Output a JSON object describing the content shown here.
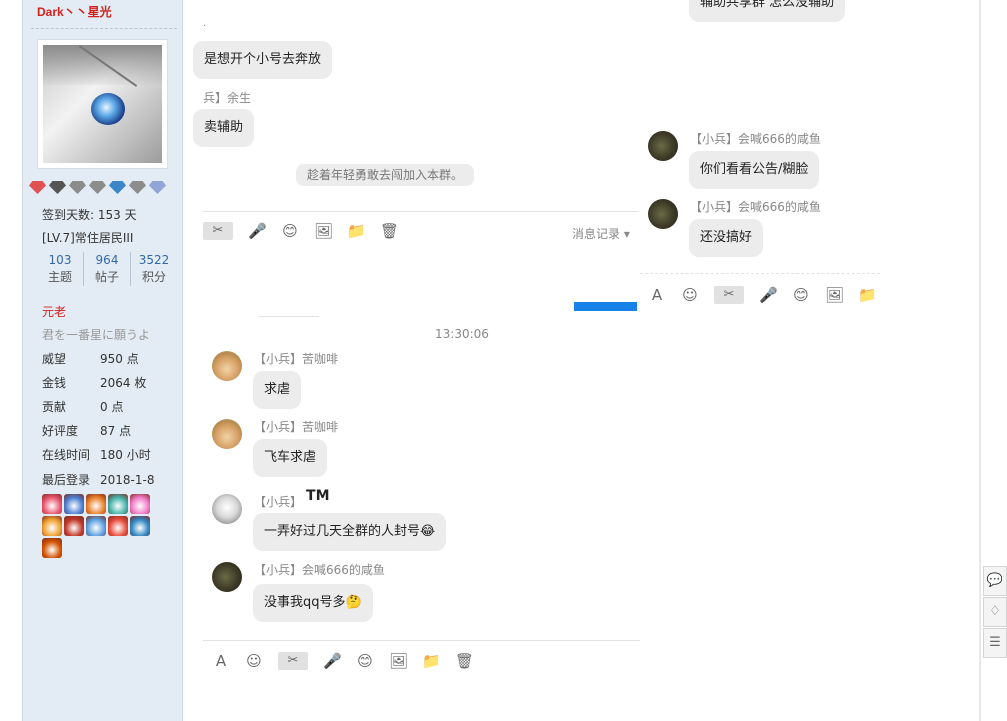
{
  "profile": {
    "username": "Dark丶丶星光",
    "checkin": "签到天数: 153 天",
    "level": "[LV.7]常住居民III",
    "stats": [
      {
        "num": "103",
        "label": "主题"
      },
      {
        "num": "964",
        "label": "帖子"
      },
      {
        "num": "3522",
        "label": "积分"
      }
    ],
    "rank": "元老",
    "motto": "君を一番星に願うよ",
    "details": [
      {
        "k": "威望",
        "v": "950 点"
      },
      {
        "k": "金钱",
        "v": "2064 枚"
      },
      {
        "k": "贡献",
        "v": "0 点"
      },
      {
        "k": "好评度",
        "v": "87 点"
      },
      {
        "k": "在线时间",
        "v": "180 小时"
      },
      {
        "k": "最后登录",
        "v": "2018-1-8"
      }
    ],
    "badge_colors": [
      "#e05252",
      "#555555",
      "#8c8c8c",
      "#8c8c8c",
      "#3a86c8",
      "#8c8c8c",
      "#8fa6d6"
    ],
    "medal_colors": [
      "#e8576f",
      "#4a7fd4",
      "#e87f2a",
      "#43b3a8",
      "#f07ac6",
      "#f0a030",
      "#c0392b",
      "#5aa0e0",
      "#e74c3c",
      "#2e86c1",
      "#d35400"
    ]
  },
  "upper_left": {
    "msg1": "是想开个小号去奔放",
    "sender2": "兵】余生",
    "msg2": "卖辅助",
    "system": "趁着年轻勇敢去闯加入本群。",
    "history": "消息记录",
    "tools": [
      "✂",
      "🎤",
      "😊",
      "🖼",
      "📁",
      "🗑"
    ]
  },
  "upper_right": {
    "msg0": "辅助共享群   怎么没辅助",
    "sender1": "【小兵】会喊666的咸鱼",
    "msg1": "你们看看公告/糊脸",
    "sender2": "【小兵】会喊666的咸鱼",
    "msg2": "还没搞好",
    "tools": [
      "A",
      "☺",
      "✂",
      "🎤",
      "😊",
      "🖼",
      "📁"
    ]
  },
  "lower": {
    "timestamp": "13:30:06",
    "messages": [
      {
        "sender": "【小兵】苦咖啡",
        "text": "求虐"
      },
      {
        "sender": "【小兵】苦咖啡",
        "text": "飞车求虐"
      },
      {
        "sender": "【小兵】",
        "name_bold": "TM",
        "text": "一弄好过几天全群的人封号😂"
      },
      {
        "sender": "【小兵】会喊666的咸鱼",
        "text": "没事我qq号多🤔"
      }
    ],
    "tools": [
      "A",
      "☺",
      "✂",
      "🎤",
      "😊",
      "🖼",
      "📁",
      "🗑"
    ]
  },
  "side": {
    "buttons": [
      "💬",
      "♢",
      "☰"
    ]
  }
}
